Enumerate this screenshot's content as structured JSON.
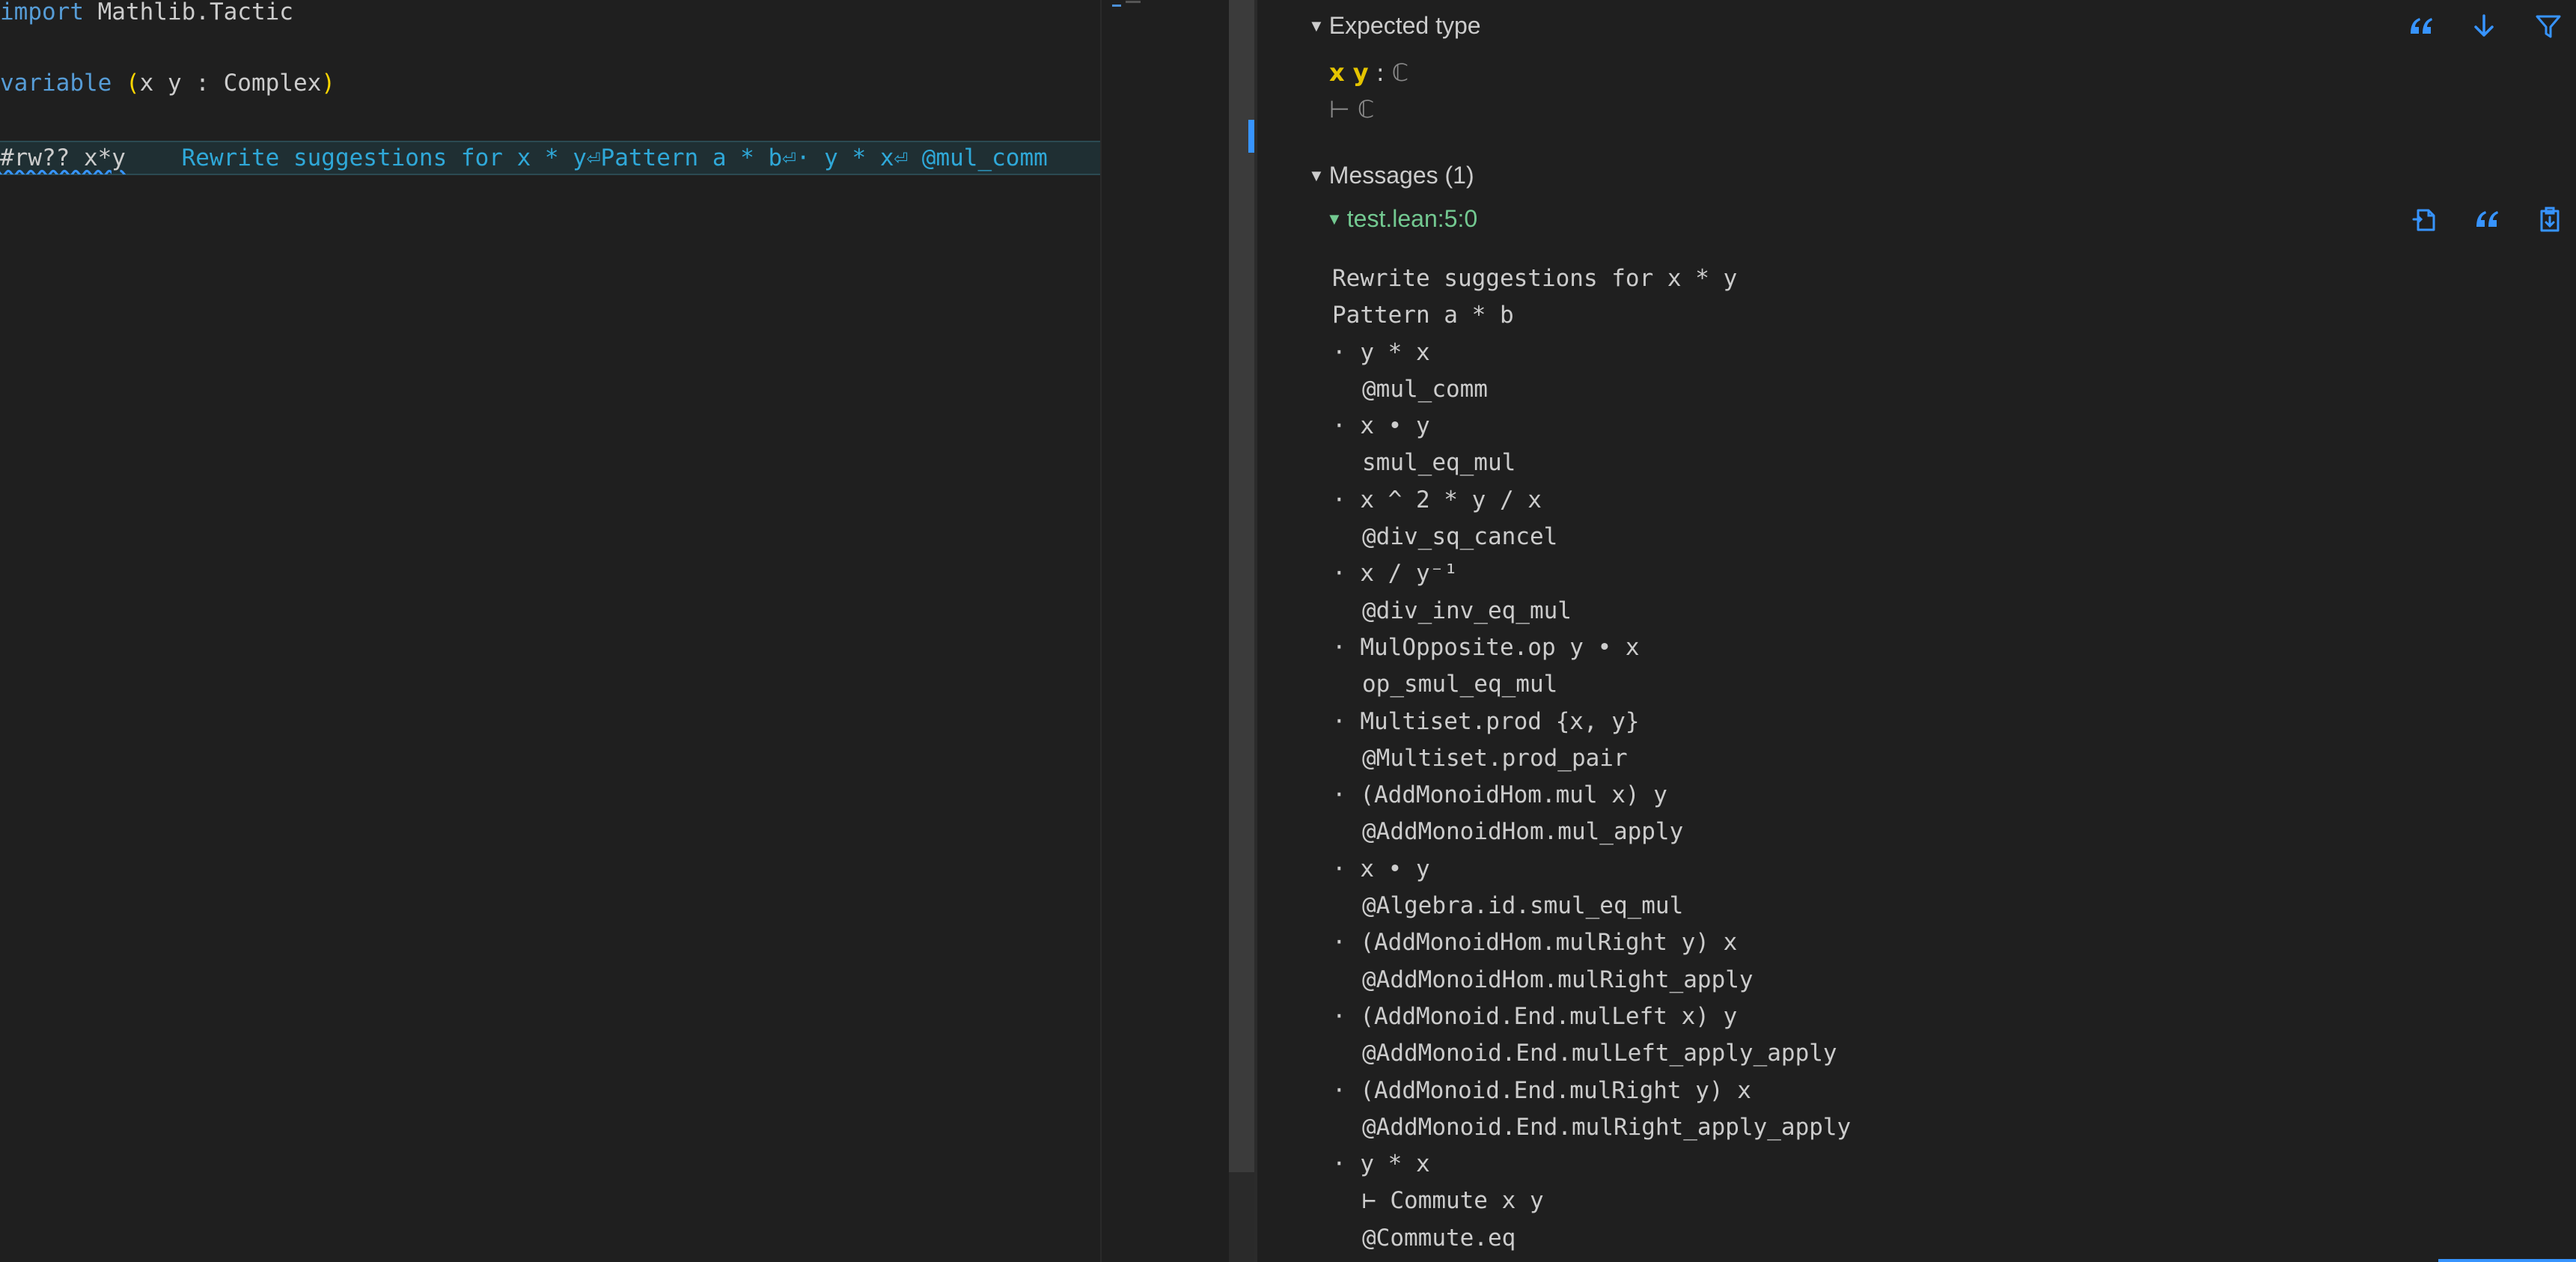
{
  "editor": {
    "lines": [
      {
        "kw": "import",
        "rest": " Mathlib.Tactic"
      },
      {
        "kw": "variable",
        "rest_pre": " ",
        "lparen": "(",
        "inner": "x y : Complex",
        "rparen": ")"
      },
      {
        "cmd": "#rw?? x*y",
        "hint": "    Rewrite suggestions for x * y⏎Pattern a * b⏎· y * x⏎ @mul_comm"
      }
    ]
  },
  "infoview": {
    "expected_type": {
      "header": "Expected type",
      "hyp_names": "x y",
      "colon": " : ",
      "hyp_type": "ℂ",
      "goal": "⊢ ℂ"
    },
    "messages": {
      "header": "Messages (1)",
      "location": "test.lean:5:0",
      "lines": [
        {
          "text": "Rewrite suggestions for x * y",
          "indent": false
        },
        {
          "text": "Pattern a * b",
          "indent": false
        },
        {
          "text": "· y * x",
          "indent": false
        },
        {
          "text": "@mul_comm",
          "indent": true
        },
        {
          "text": "· x • y",
          "indent": false
        },
        {
          "text": "smul_eq_mul",
          "indent": true
        },
        {
          "text": "· x ^ 2 * y / x",
          "indent": false
        },
        {
          "text": "@div_sq_cancel",
          "indent": true
        },
        {
          "text": "· x / y⁻¹",
          "indent": false
        },
        {
          "text": "@div_inv_eq_mul",
          "indent": true
        },
        {
          "text": "· MulOpposite.op y • x",
          "indent": false
        },
        {
          "text": "op_smul_eq_mul",
          "indent": true
        },
        {
          "text": "· Multiset.prod {x, y}",
          "indent": false
        },
        {
          "text": "@Multiset.prod_pair",
          "indent": true
        },
        {
          "text": "· (AddMonoidHom.mul x) y",
          "indent": false
        },
        {
          "text": "@AddMonoidHom.mul_apply",
          "indent": true
        },
        {
          "text": "· x • y",
          "indent": false
        },
        {
          "text": "@Algebra.id.smul_eq_mul",
          "indent": true
        },
        {
          "text": "· (AddMonoidHom.mulRight y) x",
          "indent": false
        },
        {
          "text": "@AddMonoidHom.mulRight_apply",
          "indent": true
        },
        {
          "text": "· (AddMonoid.End.mulLeft x) y",
          "indent": false
        },
        {
          "text": "@AddMonoid.End.mulLeft_apply_apply",
          "indent": true
        },
        {
          "text": "· (AddMonoid.End.mulRight y) x",
          "indent": false
        },
        {
          "text": "@AddMonoid.End.mulRight_apply_apply",
          "indent": true
        },
        {
          "text": "· y * x",
          "indent": false
        },
        {
          "text": "⊢ Commute x y",
          "indent": true
        },
        {
          "text": "@Commute.eq",
          "indent": true
        }
      ]
    },
    "icons": {
      "top": [
        "quote-icon",
        "arrow-down-icon",
        "filter-icon"
      ],
      "message": [
        "copy-to-file-icon",
        "quote-icon",
        "paste-icon"
      ]
    },
    "accent_color": "#3794ff"
  }
}
